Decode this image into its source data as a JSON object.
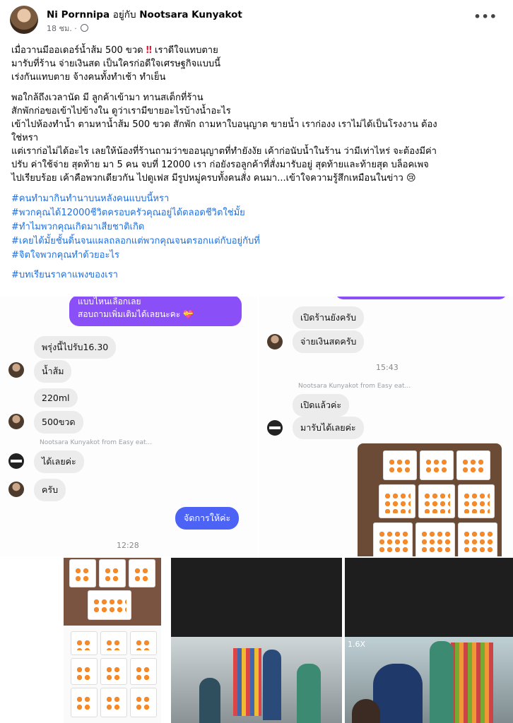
{
  "post": {
    "author": "Ni Pornnipa",
    "with_text": "อยู่กับ",
    "tagged": "Nootsara Kunyakot",
    "time": "18 ชม.",
    "more_icon": "more-options-icon",
    "lines1": [
      "เมื่อวานมีออเดอร์น้ำส้ม 500 ขวด",
      "มารับที่ร้าน จ่ายเงินสด เป็นใครก่อดีใจเศรษฐกิจแบบนี้",
      "เร่งกันแทบตาย จ้างคนทั้งทำเช้า ทำเย็น"
    ],
    "line1_tail": "เราดีใจแทบตาย",
    "lines2": [
      "พอใกล้ถึงเวลานัด มี ลูกค้าเข้ามา ทานสเต็กที่ร้าน",
      "สักพักก่อขอเข้าไปข้างใน ดูว่าเรามีขายอะไรบ้างน้ำอะไร",
      "เข้าไปห้องทำน้ำ ตามหาน้ำส้ม 500 ขวด สักพัก ถามหาใบอนุญาต ขายน้ำ เราก่องง เราไม่ได้เป็นโรงงาน ต้อง",
      "ใช่หรา",
      "แต่เราก่อไม่ได้อะไร เลยให้น้องที่ร้านถามว่าขออนุญาตที่ทำยังงัย เค้าก่อนับน้ำในร้าน ว่ามีเท่าไหร่ จะต้องมีค่า",
      "ปรับ ค่าใช้จ่าย สุดท้าย มา 5 คน จบที่ 12000 เรา ก่อยังรอลูกค้าที่สั่งมารับอยู่ สุดท้ายและท้ายสุด บล็อคเพจ",
      "ไปเรียบร้อย เค้าคือพวกเดียวกัน ไปดูเฟส มีรูปหมู่ครบทั้งคนสั่ง คนมา...เข้าใจความรู้สึกเหมือนในข่าว 😢"
    ],
    "hashtags": [
      "#คนทำมากินทำนาบนหลังคนแบบนี้หรา",
      "#พวกคุณได้12000ชีวิตครอบครัวคุณอยู่ได้ตลอดชีวิตใช่มั้ย",
      "#ทำไมพวกคุณเกิดมาเสียชาติเกิด",
      "#เคยได้มั้ยชั้นดิ้นจนแผลถลอกแต่พวกคุณจนตรอกแต่กับอยู่กับที่",
      "#จิตใจพวกคุณทำด้วยอะไร"
    ],
    "last_tag": "#บทเรียนราคาแพงของเรา"
  },
  "chat_left": {
    "purple_1": "แบบไหนเลือกเลย",
    "purple_2": "สอบถามเพิ่มเติมได้เลยนะคะ 💝",
    "m1": "พรุ่งนี้ไปรับ16.30",
    "m2": "น้ำส้ม",
    "m3": "220ml",
    "m4": "500ขวด",
    "sender": "Nootsara Kunyakot from Easy eat...",
    "m5": "ได้เลยค่ะ",
    "m6": "ครับ",
    "m7": "จัดการให้ค่ะ",
    "time": "12:28"
  },
  "chat_right": {
    "m1": "เปิดร้านยังครับ",
    "m2": "จ่ายเงินสดครับ",
    "time": "15:43",
    "sender": "Nootsara Kunyakot from Easy eat...",
    "m3": "เปิดแล้วค่ะ",
    "m4": "มารับได้เลยค่ะ"
  },
  "cctv_label": "1.6X",
  "colors": {
    "link": "#216fdb",
    "bubble": "#ececec",
    "purple": "#8a4ff7",
    "blue": "#4d63f5"
  }
}
